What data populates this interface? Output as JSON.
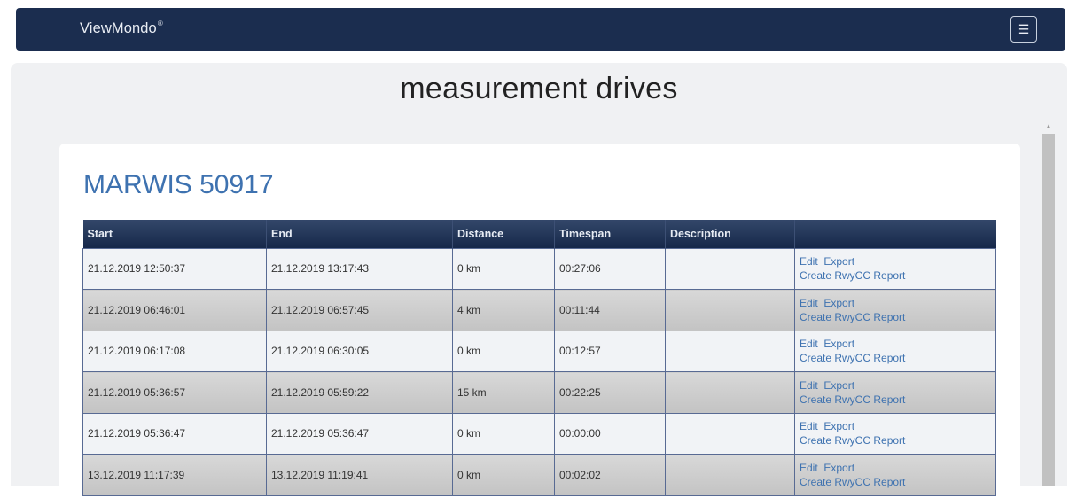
{
  "navbar": {
    "brand": "ViewMondo",
    "brand_mark": "®",
    "menu_icon": "☰"
  },
  "page": {
    "title": "measurement drives"
  },
  "vehicle": {
    "title": "MARWIS 50917"
  },
  "table": {
    "headers": [
      "Start",
      "End",
      "Distance",
      "Timespan",
      "Description",
      ""
    ],
    "actions": {
      "edit": "Edit",
      "export": "Export",
      "report": "Create RwyCC Report"
    },
    "rows": [
      {
        "start": "21.12.2019 12:50:37",
        "end": "21.12.2019 13:17:43",
        "distance": "0 km",
        "timespan": "00:27:06",
        "description": ""
      },
      {
        "start": "21.12.2019 06:46:01",
        "end": "21.12.2019 06:57:45",
        "distance": "4 km",
        "timespan": "00:11:44",
        "description": ""
      },
      {
        "start": "21.12.2019 06:17:08",
        "end": "21.12.2019 06:30:05",
        "distance": "0 km",
        "timespan": "00:12:57",
        "description": ""
      },
      {
        "start": "21.12.2019 05:36:57",
        "end": "21.12.2019 05:59:22",
        "distance": "15 km",
        "timespan": "00:22:25",
        "description": ""
      },
      {
        "start": "21.12.2019 05:36:47",
        "end": "21.12.2019 05:36:47",
        "distance": "0 km",
        "timespan": "00:00:00",
        "description": ""
      },
      {
        "start": "13.12.2019 11:17:39",
        "end": "13.12.2019 11:19:41",
        "distance": "0 km",
        "timespan": "00:02:02",
        "description": ""
      }
    ]
  },
  "colors": {
    "navbar_bg": "#1b2d4f",
    "link": "#3e72b0",
    "header_bg": "#1f3357"
  }
}
